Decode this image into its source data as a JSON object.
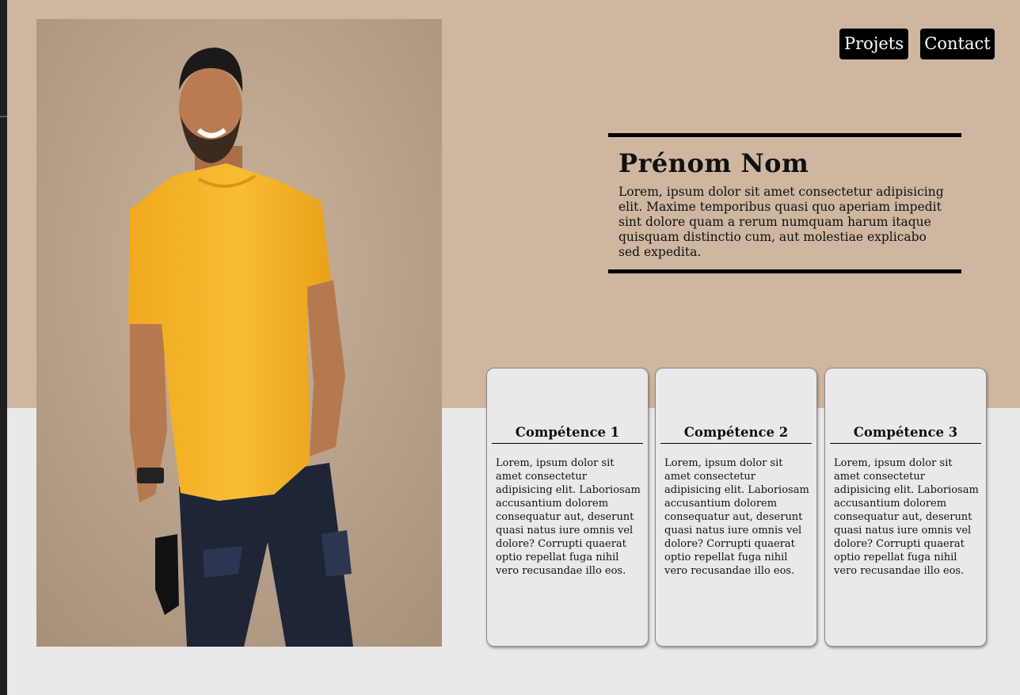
{
  "nav": {
    "projets_label": "Projets",
    "contact_label": "Contact"
  },
  "intro": {
    "name": "Prénom Nom",
    "description": "Lorem, ipsum dolor sit amet consectetur adipisicing elit. Maxime temporibus quasi quo aperiam impedit sint dolore quam a rerum numquam harum itaque quisquam distinctio cum, aut molestiae explicabo sed expedita."
  },
  "skills": [
    {
      "title": "Compétence 1",
      "text": "Lorem, ipsum dolor sit amet consectetur adipisicing elit. Laboriosam accusantium dolorem consequatur aut, deserunt quasi natus iure omnis vel dolore? Corrupti quaerat optio repellat fuga nihil vero recusandae illo eos."
    },
    {
      "title": "Compétence 2",
      "text": "Lorem, ipsum dolor sit amet consectetur adipisicing elit. Laboriosam accusantium dolorem consequatur aut, deserunt quasi natus iure omnis vel dolore? Corrupti quaerat optio repellat fuga nihil vero recusandae illo eos."
    },
    {
      "title": "Compétence 3",
      "text": "Lorem, ipsum dolor sit amet consectetur adipisicing elit. Laboriosam accusantium dolorem consequatur aut, deserunt quasi natus iure omnis vel dolore? Corrupti quaerat optio repellat fuga nihil vero recusandae illo eos."
    }
  ],
  "colors": {
    "top_band": "#cfb6a0",
    "page_background": "#e9e9e9",
    "button_background": "#000000",
    "shirt": "#f5b62a"
  }
}
